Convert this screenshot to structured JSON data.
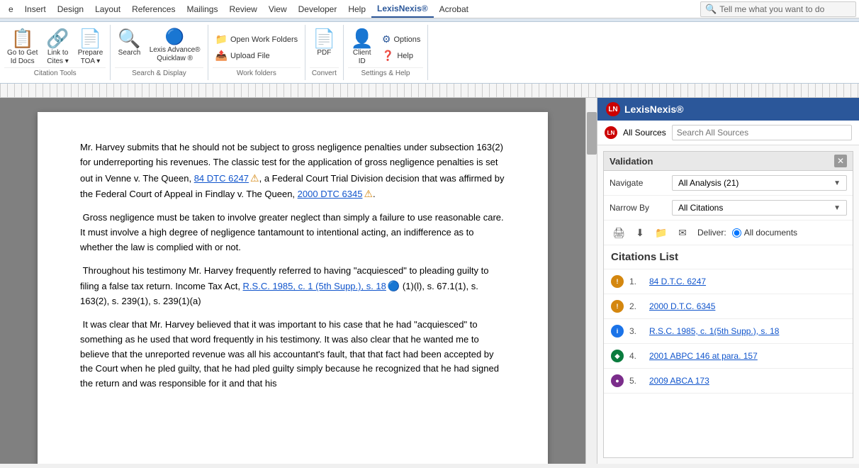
{
  "menu": {
    "items": [
      "e",
      "Insert",
      "Design",
      "Layout",
      "References",
      "Mailings",
      "Review",
      "View",
      "Developer",
      "Help",
      "LexisNexis®",
      "Acrobat"
    ],
    "active": "LexisNexis®",
    "search_placeholder": "Tell me what you want to do"
  },
  "ribbon": {
    "citation_tools_group": {
      "label": "Citation Tools",
      "buttons": [
        {
          "icon": "📋",
          "label": "Go to Get\nId Docs"
        },
        {
          "icon": "🔗",
          "label": "Link to\nCites ▾"
        },
        {
          "icon": "📄",
          "label": "Prepare\nTOA ▾"
        }
      ]
    },
    "search_display_group": {
      "label": "Search & Display",
      "buttons": [
        {
          "icon": "🔍",
          "label": "Search"
        },
        {
          "icon": "🔵",
          "label": "Lexis Advance®\nQuicklaw ®"
        }
      ]
    },
    "work_folders_group": {
      "label": "Work folders",
      "small_buttons": [
        {
          "icon": "📁",
          "label": "Open Work Folders"
        },
        {
          "icon": "📤",
          "label": "Upload File"
        }
      ]
    },
    "convert_group": {
      "label": "Convert",
      "buttons": [
        {
          "icon": "📄",
          "label": "PDF"
        }
      ]
    },
    "settings_group": {
      "label": "Settings & Help",
      "buttons": [
        {
          "icon": "👤",
          "label": "Client\nID"
        }
      ],
      "small_buttons": [
        {
          "icon": "⚙",
          "label": "Options"
        },
        {
          "icon": "❓",
          "label": "Help"
        }
      ]
    }
  },
  "document": {
    "paragraphs": [
      "Mr. Harvey submits that he should not be subject to gross negligence penalties under subsection 163(2) for underreporting his revenues. The classic test for the application of gross negligence penalties is set out in Venne v. The Queen, 84 DTC 6247 ⚠, a Federal Court Trial Division decision that was affirmed by the Federal Court of Appeal in Findlay v. The Queen, 2000 DTC 6345 ⚠.",
      "Gross negligence must be taken to involve greater neglect than simply a failure to use reasonable care. It must involve a high degree of negligence tantamount to intentional acting, an indifference as to whether the law is complied with or not.",
      "Throughout his testimony Mr. Harvey frequently referred to having \"acquiesced\" to pleading guilty to filing a false tax return. Income Tax Act, R.S.C. 1985, c. 1 (5th Supp.), s. 18 🔵 (1)(l), s. 67.1(1), s. 163(2), s. 239(1), s. 239(1)(a)",
      "It was clear that Mr. Harvey believed that it was important to his case that he had \"acquiesced\" to something as he used that word frequently in his testimony. It was also clear that he wanted me to believe that the unreported revenue was all his accountant's fault, that that fact had been accepted by the Court when he pled guilty, that he had pled guilty simply because he recognized that he had signed the return and was responsible for it and that his"
    ],
    "links": [
      {
        "text": "84 DTC 6247",
        "type": "warning"
      },
      {
        "text": "2000 DTC 6345",
        "type": "warning"
      },
      {
        "text": "R.S.C. 1985, c. 1 (5th Supp.), s. 18",
        "type": "info"
      }
    ]
  },
  "right_panel": {
    "title": "LexisNexis®",
    "sources_label": "All Sources",
    "sources_placeholder": "Search All Sources",
    "validation": {
      "title": "Validation",
      "navigate_label": "Navigate",
      "navigate_value": "All Analysis (21)",
      "narrow_label": "Narrow By",
      "narrow_value": "All Citations",
      "toolbar_icons": [
        "print",
        "download",
        "folder",
        "email"
      ],
      "deliver_label": "Deliver:",
      "deliver_option": "All documents"
    },
    "citations": {
      "title": "Citations List",
      "items": [
        {
          "num": "1.",
          "text": "84 D.T.C. 6247",
          "icon_type": "yellow",
          "icon_label": "!"
        },
        {
          "num": "2.",
          "text": "2000 D.T.C. 6345",
          "icon_type": "yellow",
          "icon_label": "!"
        },
        {
          "num": "3.",
          "text": "R.S.C. 1985, c. 1(5th Supp.), s. 18",
          "icon_type": "blue",
          "icon_label": "i"
        },
        {
          "num": "4.",
          "text": "2001 ABPC 146 at para. 157",
          "icon_type": "green",
          "icon_label": "◆"
        },
        {
          "num": "5.",
          "text": "2009 ABCA 173",
          "icon_type": "purple",
          "icon_label": "●"
        }
      ]
    }
  }
}
